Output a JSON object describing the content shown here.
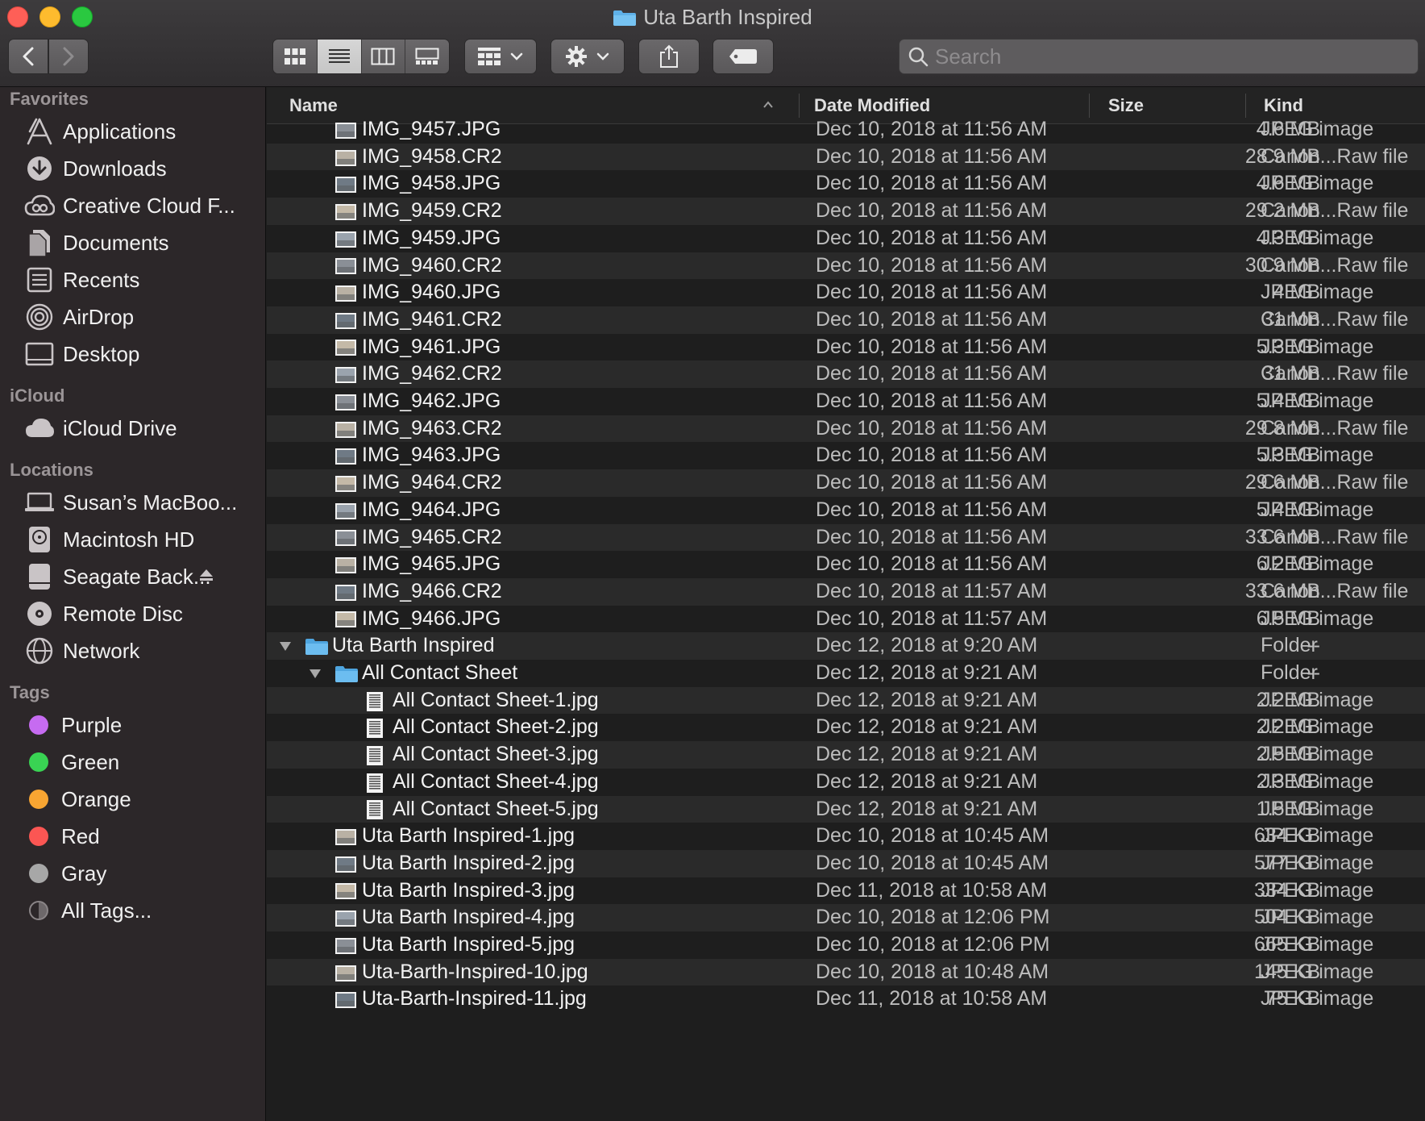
{
  "window": {
    "title": "Uta Barth Inspired"
  },
  "toolbar": {
    "back_icon": "chevron-left-icon",
    "forward_icon": "chevron-right-icon",
    "views": [
      "icon-view",
      "list-view",
      "column-view",
      "gallery-view"
    ],
    "active_view": "list-view",
    "search_placeholder": "Search"
  },
  "sidebar": {
    "sections": [
      {
        "header": "Favorites",
        "items": [
          {
            "label": "Applications",
            "icon": "applications-icon"
          },
          {
            "label": "Downloads",
            "icon": "downloads-icon"
          },
          {
            "label": "Creative Cloud F...",
            "icon": "creative-cloud-icon"
          },
          {
            "label": "Documents",
            "icon": "documents-icon"
          },
          {
            "label": "Recents",
            "icon": "recents-icon"
          },
          {
            "label": "AirDrop",
            "icon": "airdrop-icon"
          },
          {
            "label": "Desktop",
            "icon": "desktop-icon"
          }
        ]
      },
      {
        "header": "iCloud",
        "items": [
          {
            "label": "iCloud Drive",
            "icon": "cloud-icon"
          }
        ]
      },
      {
        "header": "Locations",
        "items": [
          {
            "label": "Susan’s MacBoo...",
            "icon": "laptop-icon"
          },
          {
            "label": "Macintosh HD",
            "icon": "hard-drive-icon"
          },
          {
            "label": "Seagate Back...",
            "icon": "external-drive-icon",
            "eject": true
          },
          {
            "label": "Remote Disc",
            "icon": "disc-icon"
          },
          {
            "label": "Network",
            "icon": "network-icon"
          }
        ]
      }
    ],
    "tags_header": "Tags",
    "tags": [
      {
        "label": "Purple",
        "color": "#c66bf1"
      },
      {
        "label": "Green",
        "color": "#39d353"
      },
      {
        "label": "Orange",
        "color": "#f8a532"
      },
      {
        "label": "Red",
        "color": "#fb5653"
      },
      {
        "label": "Gray",
        "color": "#a7a7a7"
      },
      {
        "label": "All Tags...",
        "color": "none"
      }
    ]
  },
  "columns": {
    "name": "Name",
    "date": "Date Modified",
    "size": "Size",
    "kind": "Kind"
  },
  "files": [
    {
      "name": "IMG_9457.JPG",
      "date": "Dec 10, 2018 at 11:56 AM",
      "size": "4.6 MB",
      "kind": "JPEG image",
      "level": 1,
      "icon": "photo-icon"
    },
    {
      "name": "IMG_9458.CR2",
      "date": "Dec 10, 2018 at 11:56 AM",
      "size": "28.9 MB",
      "kind": "Canon...Raw file",
      "level": 1,
      "icon": "photo-icon"
    },
    {
      "name": "IMG_9458.JPG",
      "date": "Dec 10, 2018 at 11:56 AM",
      "size": "4.6 MB",
      "kind": "JPEG image",
      "level": 1,
      "icon": "photo-icon"
    },
    {
      "name": "IMG_9459.CR2",
      "date": "Dec 10, 2018 at 11:56 AM",
      "size": "29.2 MB",
      "kind": "Canon...Raw file",
      "level": 1,
      "icon": "photo-icon"
    },
    {
      "name": "IMG_9459.JPG",
      "date": "Dec 10, 2018 at 11:56 AM",
      "size": "4.3 MB",
      "kind": "JPEG image",
      "level": 1,
      "icon": "photo-icon"
    },
    {
      "name": "IMG_9460.CR2",
      "date": "Dec 10, 2018 at 11:56 AM",
      "size": "30.9 MB",
      "kind": "Canon...Raw file",
      "level": 1,
      "icon": "photo-icon"
    },
    {
      "name": "IMG_9460.JPG",
      "date": "Dec 10, 2018 at 11:56 AM",
      "size": "4 MB",
      "kind": "JPEG image",
      "level": 1,
      "icon": "photo-icon"
    },
    {
      "name": "IMG_9461.CR2",
      "date": "Dec 10, 2018 at 11:56 AM",
      "size": "31 MB",
      "kind": "Canon...Raw file",
      "level": 1,
      "icon": "photo-icon"
    },
    {
      "name": "IMG_9461.JPG",
      "date": "Dec 10, 2018 at 11:56 AM",
      "size": "5.3 MB",
      "kind": "JPEG image",
      "level": 1,
      "icon": "photo-icon"
    },
    {
      "name": "IMG_9462.CR2",
      "date": "Dec 10, 2018 at 11:56 AM",
      "size": "31 MB",
      "kind": "Canon...Raw file",
      "level": 1,
      "icon": "photo-icon"
    },
    {
      "name": "IMG_9462.JPG",
      "date": "Dec 10, 2018 at 11:56 AM",
      "size": "5.4 MB",
      "kind": "JPEG image",
      "level": 1,
      "icon": "photo-icon"
    },
    {
      "name": "IMG_9463.CR2",
      "date": "Dec 10, 2018 at 11:56 AM",
      "size": "29.8 MB",
      "kind": "Canon...Raw file",
      "level": 1,
      "icon": "photo-icon"
    },
    {
      "name": "IMG_9463.JPG",
      "date": "Dec 10, 2018 at 11:56 AM",
      "size": "5.3 MB",
      "kind": "JPEG image",
      "level": 1,
      "icon": "photo-icon"
    },
    {
      "name": "IMG_9464.CR2",
      "date": "Dec 10, 2018 at 11:56 AM",
      "size": "29.6 MB",
      "kind": "Canon...Raw file",
      "level": 1,
      "icon": "photo-icon"
    },
    {
      "name": "IMG_9464.JPG",
      "date": "Dec 10, 2018 at 11:56 AM",
      "size": "5.4 MB",
      "kind": "JPEG image",
      "level": 1,
      "icon": "photo-icon"
    },
    {
      "name": "IMG_9465.CR2",
      "date": "Dec 10, 2018 at 11:56 AM",
      "size": "33.6 MB",
      "kind": "Canon...Raw file",
      "level": 1,
      "icon": "photo-icon"
    },
    {
      "name": "IMG_9465.JPG",
      "date": "Dec 10, 2018 at 11:56 AM",
      "size": "6.2 MB",
      "kind": "JPEG image",
      "level": 1,
      "icon": "photo-icon"
    },
    {
      "name": "IMG_9466.CR2",
      "date": "Dec 10, 2018 at 11:57 AM",
      "size": "33.6 MB",
      "kind": "Canon...Raw file",
      "level": 1,
      "icon": "photo-icon"
    },
    {
      "name": "IMG_9466.JPG",
      "date": "Dec 10, 2018 at 11:57 AM",
      "size": "6.5 MB",
      "kind": "JPEG image",
      "level": 1,
      "icon": "photo-icon"
    },
    {
      "name": "Uta Barth Inspired",
      "date": "Dec 12, 2018 at 9:20 AM",
      "size": "--",
      "kind": "Folder",
      "level": 0,
      "icon": "folder-icon",
      "expanded": true
    },
    {
      "name": "All Contact Sheet",
      "date": "Dec 12, 2018 at 9:21 AM",
      "size": "--",
      "kind": "Folder",
      "level": 1,
      "icon": "folder-icon",
      "expanded": true
    },
    {
      "name": "All Contact Sheet-1.jpg",
      "date": "Dec 12, 2018 at 9:21 AM",
      "size": "2.2 MB",
      "kind": "JPEG image",
      "level": 2,
      "icon": "contact-sheet-icon"
    },
    {
      "name": "All Contact Sheet-2.jpg",
      "date": "Dec 12, 2018 at 9:21 AM",
      "size": "2.2 MB",
      "kind": "JPEG image",
      "level": 2,
      "icon": "contact-sheet-icon"
    },
    {
      "name": "All Contact Sheet-3.jpg",
      "date": "Dec 12, 2018 at 9:21 AM",
      "size": "2.5 MB",
      "kind": "JPEG image",
      "level": 2,
      "icon": "contact-sheet-icon"
    },
    {
      "name": "All Contact Sheet-4.jpg",
      "date": "Dec 12, 2018 at 9:21 AM",
      "size": "2.3 MB",
      "kind": "JPEG image",
      "level": 2,
      "icon": "contact-sheet-icon"
    },
    {
      "name": "All Contact Sheet-5.jpg",
      "date": "Dec 12, 2018 at 9:21 AM",
      "size": "1.5 MB",
      "kind": "JPEG image",
      "level": 2,
      "icon": "contact-sheet-icon"
    },
    {
      "name": "Uta Barth Inspired-1.jpg",
      "date": "Dec 10, 2018 at 10:45 AM",
      "size": "634 KB",
      "kind": "JPEG image",
      "level": 1,
      "icon": "photo-icon"
    },
    {
      "name": "Uta Barth Inspired-2.jpg",
      "date": "Dec 10, 2018 at 10:45 AM",
      "size": "577 KB",
      "kind": "JPEG image",
      "level": 1,
      "icon": "photo-icon"
    },
    {
      "name": "Uta Barth Inspired-3.jpg",
      "date": "Dec 11, 2018 at 10:58 AM",
      "size": "334 KB",
      "kind": "JPEG image",
      "level": 1,
      "icon": "photo-icon"
    },
    {
      "name": "Uta Barth Inspired-4.jpg",
      "date": "Dec 10, 2018 at 12:06 PM",
      "size": "504 KB",
      "kind": "JPEG image",
      "level": 1,
      "icon": "photo-icon"
    },
    {
      "name": "Uta Barth Inspired-5.jpg",
      "date": "Dec 10, 2018 at 12:06 PM",
      "size": "665 KB",
      "kind": "JPEG image",
      "level": 1,
      "icon": "photo-icon"
    },
    {
      "name": "Uta-Barth-Inspired-10.jpg",
      "date": "Dec 10, 2018 at 10:48 AM",
      "size": "145 KB",
      "kind": "JPEG image",
      "level": 1,
      "icon": "photo-icon"
    },
    {
      "name": "Uta-Barth-Inspired-11.jpg",
      "date": "Dec 11, 2018 at 10:58 AM",
      "size": "75 KB",
      "kind": "JPEG image",
      "level": 1,
      "icon": "photo-icon"
    }
  ]
}
